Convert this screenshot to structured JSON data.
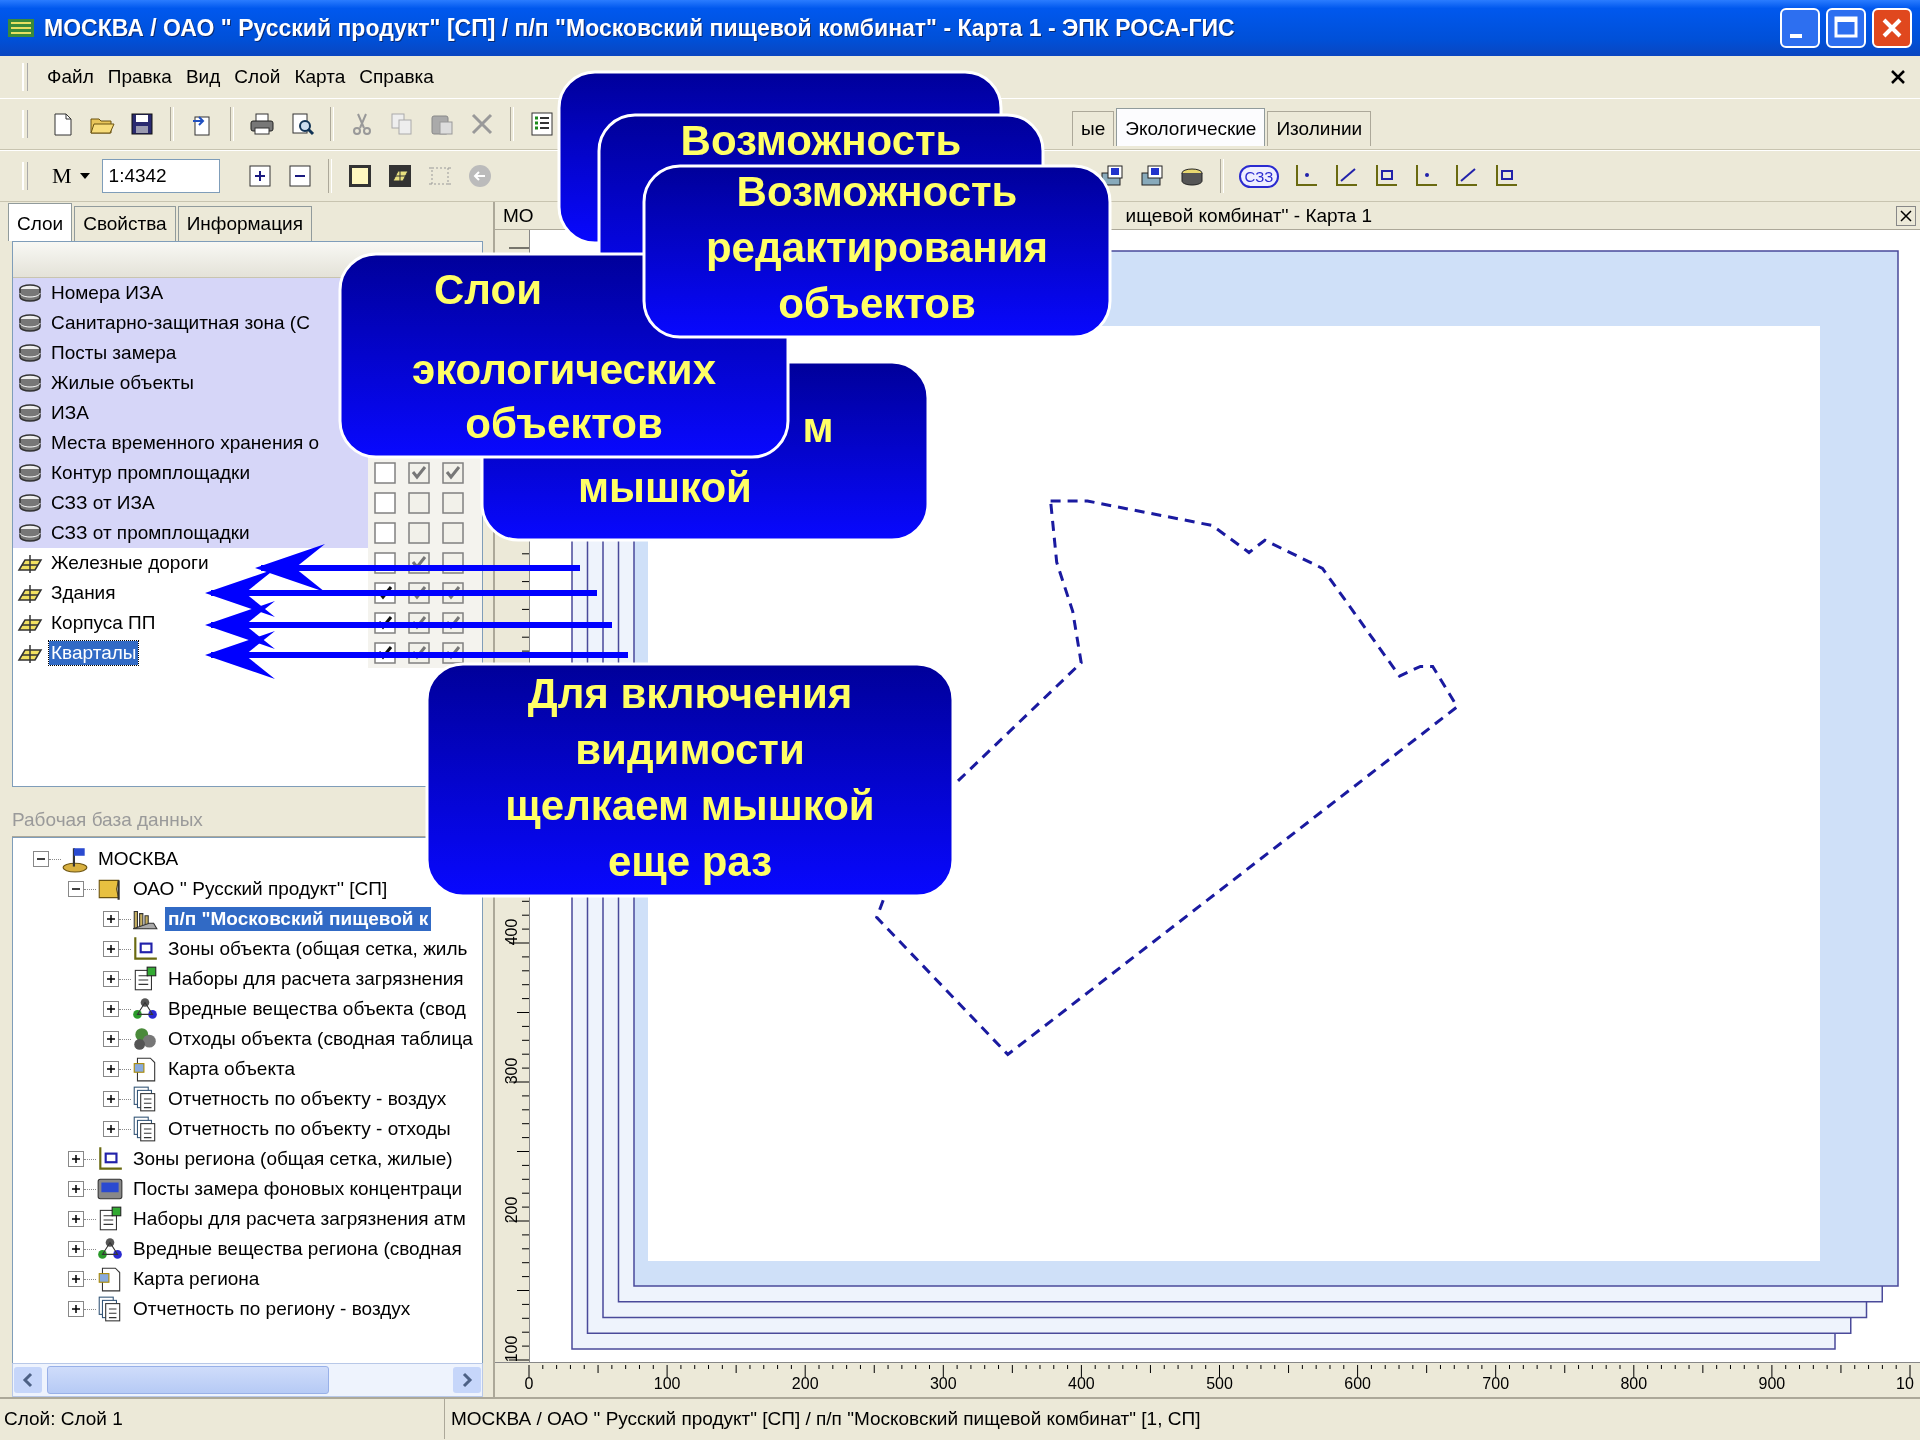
{
  "window": {
    "title": "МОСКВА / ОАО \" Русский продукт\"  [СП] / п/п \"Московский пищевой комбинат\"  -  Карта 1  -  ЭПК РОСА-ГИС"
  },
  "menu": [
    "Файл",
    "Правка",
    "Вид",
    "Слой",
    "Карта",
    "Справка"
  ],
  "toolbar": {
    "scale_label": "М",
    "scale": "1:4342",
    "badge": "СЗЗ"
  },
  "layer_tabs": [
    {
      "label": "ые",
      "selected": false
    },
    {
      "label": "Экологические",
      "selected": true
    },
    {
      "label": "Изолинии",
      "selected": false
    }
  ],
  "panel_tabs": [
    {
      "label": "Слои",
      "selected": true
    },
    {
      "label": "Свойства",
      "selected": false
    },
    {
      "label": "Информация",
      "selected": false
    }
  ],
  "layers": [
    {
      "name": "Номера ИЗА",
      "kind": "db",
      "highlighted": true,
      "selected": false
    },
    {
      "name": "Санитарно-защитная зона (С",
      "kind": "db",
      "highlighted": true,
      "selected": false
    },
    {
      "name": "Посты замера",
      "kind": "db",
      "highlighted": true,
      "selected": false
    },
    {
      "name": "Жилые объекты",
      "kind": "db",
      "highlighted": true,
      "selected": false
    },
    {
      "name": "ИЗА",
      "kind": "db",
      "highlighted": true,
      "selected": false
    },
    {
      "name": "Места временного хранения о",
      "kind": "db",
      "highlighted": true,
      "selected": false
    },
    {
      "name": "Контур промплощадки",
      "kind": "db",
      "highlighted": true,
      "selected": false,
      "checks": [
        {
          "checked": false
        },
        {
          "checked": true
        },
        {
          "checked": true
        }
      ]
    },
    {
      "name": "СЗЗ от ИЗА",
      "kind": "db",
      "highlighted": true,
      "selected": false,
      "checks": [
        {
          "checked": false
        },
        {
          "checked": false
        },
        {
          "checked": false
        }
      ]
    },
    {
      "name": "СЗЗ от промплощадки",
      "kind": "db",
      "highlighted": true,
      "selected": false,
      "checks": [
        {
          "checked": false
        },
        {
          "checked": false
        },
        {
          "checked": false
        }
      ]
    },
    {
      "name": "Железные дороги",
      "kind": "vector",
      "highlighted": false,
      "selected": false,
      "checks": [
        {
          "checked": false
        },
        {
          "checked": true
        },
        {
          "checked": false
        }
      ]
    },
    {
      "name": "Здания",
      "kind": "vector",
      "highlighted": false,
      "selected": false,
      "checks": [
        {
          "checked": true
        },
        {
          "checked": true
        },
        {
          "checked": true
        }
      ]
    },
    {
      "name": "Корпуса ПП",
      "kind": "vector",
      "highlighted": false,
      "selected": false,
      "checks": [
        {
          "checked": true
        },
        {
          "checked": true
        },
        {
          "checked": true
        }
      ]
    },
    {
      "name": "Кварталы",
      "kind": "vector",
      "highlighted": false,
      "selected": true,
      "checks": [
        {
          "checked": true
        },
        {
          "checked": true
        },
        {
          "checked": true
        }
      ]
    }
  ],
  "database": {
    "title": "Рабочая база данных",
    "tree": [
      {
        "label": "МОСКВА",
        "kind": "city",
        "expanded": true,
        "selected": false,
        "children": [
          {
            "label": "ОАО '' Русский продукт''  [СП]",
            "kind": "company",
            "expanded": true,
            "selected": false,
            "children": [
              {
                "label": "п/п \"Московский пищевой к",
                "kind": "factory",
                "expanded": false,
                "selected": true
              },
              {
                "label": "Зоны объекта (общая сетка, жиль",
                "kind": "zones",
                "expanded": false,
                "selected": false
              },
              {
                "label": "Наборы для расчета загрязнения",
                "kind": "sets",
                "expanded": false,
                "selected": false
              },
              {
                "label": "Вредные вещества объекта (свод",
                "kind": "substances",
                "expanded": false,
                "selected": false
              },
              {
                "label": "Отходы объекта (сводная таблица",
                "kind": "waste",
                "expanded": false,
                "selected": false
              },
              {
                "label": "Карта объекта",
                "kind": "map",
                "expanded": false,
                "selected": false
              },
              {
                "label": "Отчетность по объекту - воздух",
                "kind": "report",
                "expanded": false,
                "selected": false
              },
              {
                "label": "Отчетность по объекту - отходы",
                "kind": "report",
                "expanded": false,
                "selected": false
              }
            ]
          },
          {
            "label": "Зоны региона (общая сетка, жилые)",
            "kind": "zones",
            "expanded": false,
            "selected": false
          },
          {
            "label": "Посты замера фоновых концентраци",
            "kind": "station",
            "expanded": false,
            "selected": false
          },
          {
            "label": "Наборы для расчета загрязнения атм",
            "kind": "sets",
            "expanded": false,
            "selected": false
          },
          {
            "label": "Вредные вещества региона (сводная",
            "kind": "substances",
            "expanded": false,
            "selected": false
          },
          {
            "label": "Карта региона",
            "kind": "map",
            "expanded": false,
            "selected": false
          },
          {
            "label": "Отчетность по региону - воздух",
            "kind": "report",
            "expanded": false,
            "selected": false
          }
        ]
      }
    ]
  },
  "map": {
    "title_left": "МО",
    "title_right": "ищевой комбинат''  -  Карта 1",
    "y_labels": [
      "400",
      "300",
      "200",
      "100"
    ],
    "x_labels": [
      "0",
      "100",
      "200",
      "300",
      "400",
      "500",
      "600",
      "700",
      "800",
      "900",
      "10"
    ]
  },
  "callouts": [
    {
      "lines": [
        "Возможность"
      ]
    },
    {
      "lines": [
        "Возможность",
        "редактирования",
        "объектов"
      ]
    },
    {
      "lines": [
        "Слои",
        "экологических",
        "объектов"
      ]
    },
    {
      "lines": [
        "м",
        "мышкой"
      ]
    },
    {
      "lines": [
        "Для включения",
        "видимости",
        "щелкаем мышкой",
        "еще раз"
      ]
    }
  ],
  "status_bar": {
    "layer": "Слой: Слой 1",
    "path": "МОСКВА / ОАО \" Русский продукт\"  [СП] / п/п \"Московский пищевой комбинат\"  [1, СП]"
  }
}
